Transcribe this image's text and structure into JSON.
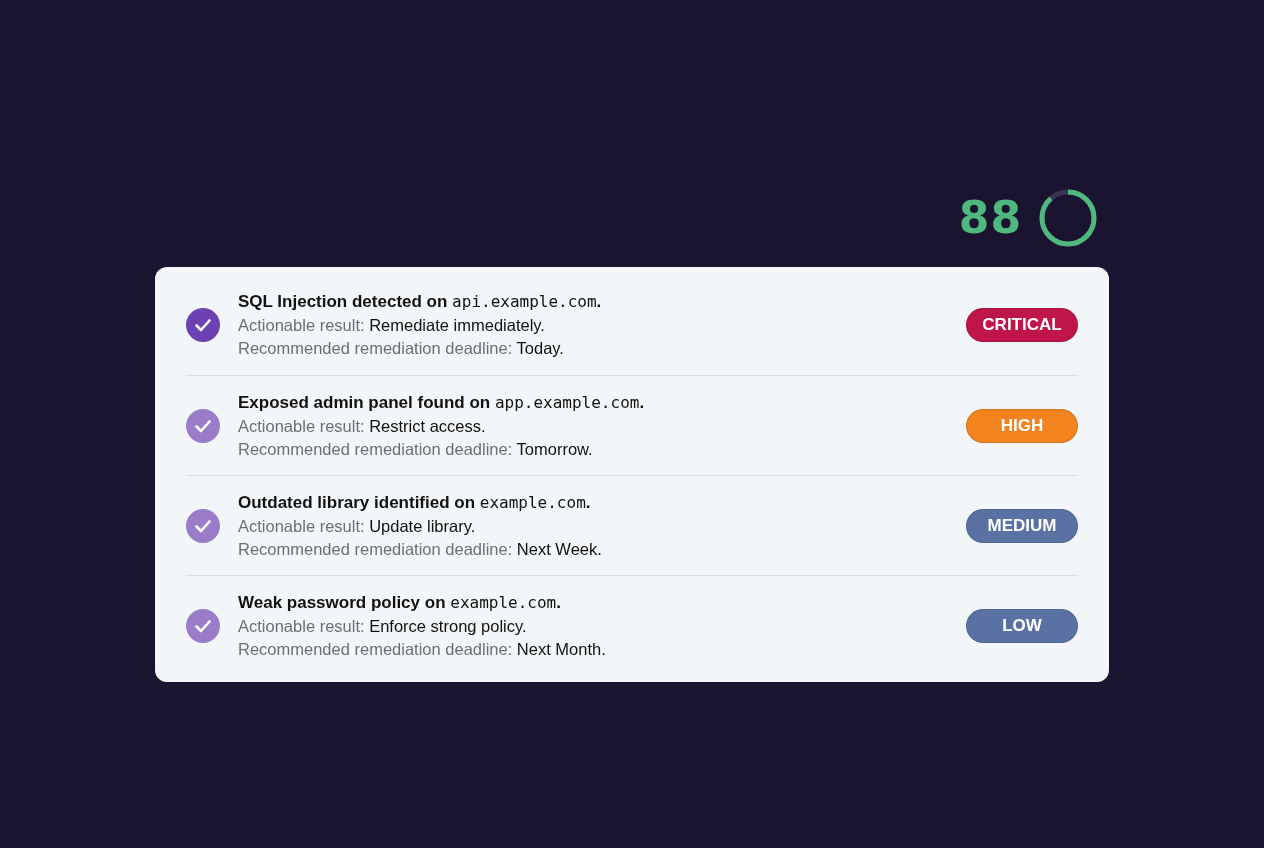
{
  "score": {
    "value": "88",
    "level": 0.88
  },
  "findings": [
    {
      "check": {
        "color": "#6c42b3"
      },
      "title": [
        {
          "kind": "text",
          "text": "SQL Injection detected on "
        },
        {
          "kind": "code",
          "text": "api.example.com"
        },
        {
          "kind": "text",
          "text": "."
        }
      ],
      "action": {
        "label": "Actionable result:",
        "value": "Remediate immediately."
      },
      "deadline": {
        "label": "Recommended remediation deadline:",
        "value": "Today."
      },
      "severity": {
        "label": "CRITICAL",
        "color": "#c0154b"
      }
    },
    {
      "check": {
        "color": "#9b7ccb"
      },
      "title": [
        {
          "kind": "text",
          "text": "Exposed admin panel found on "
        },
        {
          "kind": "code",
          "text": "app.example.com"
        },
        {
          "kind": "text",
          "text": "."
        }
      ],
      "action": {
        "label": "Actionable result:",
        "value": "Restrict access."
      },
      "deadline": {
        "label": "Recommended remediation deadline:",
        "value": "Tomorrow."
      },
      "severity": {
        "label": "HIGH",
        "color": "#f2831f"
      }
    },
    {
      "check": {
        "color": "#9b7ccb"
      },
      "title": [
        {
          "kind": "text",
          "text": "Outdated library identified on "
        },
        {
          "kind": "code",
          "text": "example.com"
        },
        {
          "kind": "text",
          "text": "."
        }
      ],
      "action": {
        "label": "Actionable result:",
        "value": "Update library."
      },
      "deadline": {
        "label": "Recommended remediation deadline:",
        "value": "Next Week."
      },
      "severity": {
        "label": "MEDIUM",
        "color": "#5a72a3"
      }
    },
    {
      "check": {
        "color": "#9b7ccb"
      },
      "title": [
        {
          "kind": "text",
          "text": "Weak password policy on "
        },
        {
          "kind": "code",
          "text": "example.com"
        },
        {
          "kind": "text",
          "text": "."
        }
      ],
      "action": {
        "label": "Actionable result:",
        "value": "Enforce strong policy."
      },
      "deadline": {
        "label": "Recommended remediation deadline:",
        "value": "Next Month."
      },
      "severity": {
        "label": "LOW",
        "color": "#5a72a3"
      }
    }
  ]
}
